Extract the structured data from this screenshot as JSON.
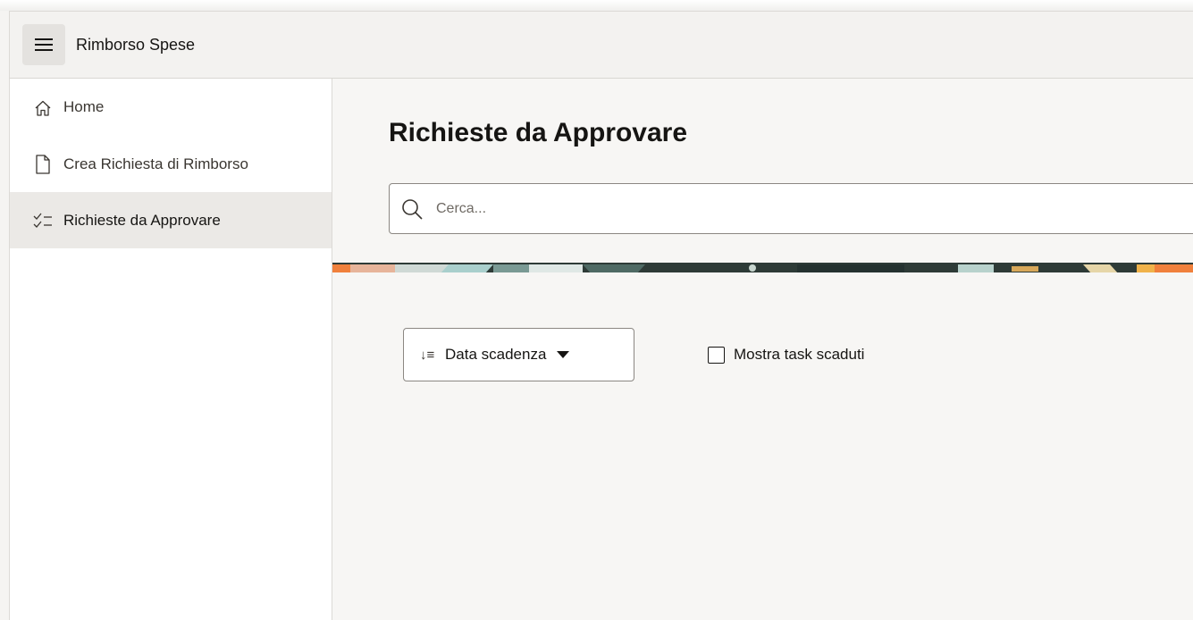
{
  "header": {
    "app_title": "Rimborso Spese",
    "menu_icon": "hamburger-menu-icon"
  },
  "sidebar": {
    "items": [
      {
        "label": "Home",
        "icon": "home-icon",
        "active": false
      },
      {
        "label": "Crea Richiesta di Rimborso",
        "icon": "document-icon",
        "active": false
      },
      {
        "label": "Richieste da Approvare",
        "icon": "checklist-icon",
        "active": true
      }
    ]
  },
  "main": {
    "title": "Richieste da Approvare",
    "search": {
      "placeholder": "Cerca...",
      "value": ""
    },
    "sort": {
      "label": "Data scadenza",
      "icon": "sort-descending-icon"
    },
    "overdue_filter": {
      "label": "Mostra task scaduti",
      "checked": false
    }
  },
  "colors": {
    "banner_orange": "#f0803c",
    "banner_dark": "#2e3b37",
    "banner_teal": "#a9cfcc",
    "active_nav_bg": "#ebe9e6"
  }
}
